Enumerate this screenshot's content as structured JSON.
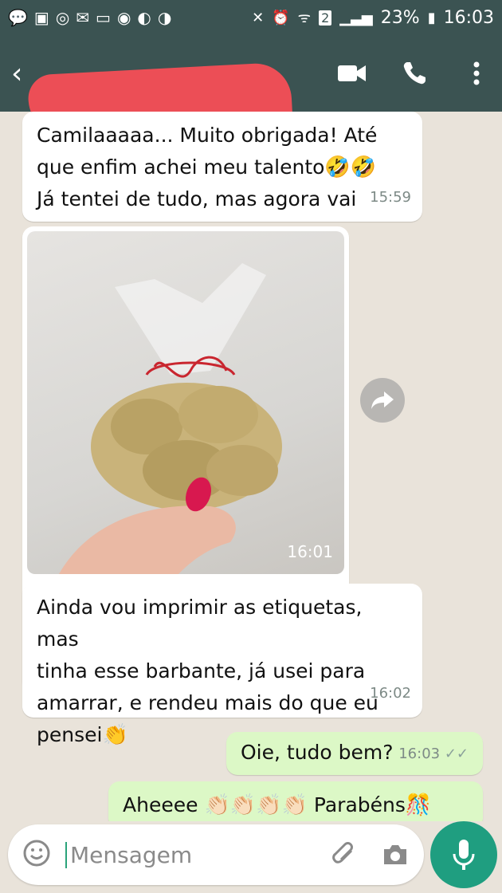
{
  "status_bar": {
    "battery": "23%",
    "time": "16:03",
    "sim": "2"
  },
  "header": {
    "contact_name": ""
  },
  "messages": [
    {
      "line1": "Camilaaaaa... Muito obrigada! Até",
      "line2": "que enfim achei meu talento",
      "line2_emoji": "🤣🤣",
      "line3": "Já tentei de tudo, mas agora vai",
      "time": "15:59"
    },
    {
      "type": "photo",
      "time": "16:01"
    },
    {
      "line1": "Ainda vou imprimir as etiquetas, mas",
      "line2": "tinha esse barbante, já usei para",
      "line3": "amarrar, e rendeu mais do que eu",
      "line4": "pensei",
      "line4_emoji": "👏",
      "time": "16:02"
    },
    {
      "text": "Oie, tudo bem?",
      "time": "16:03",
      "status": "read"
    },
    {
      "text_before": "Aheeee",
      "emojis": "👏🏻👏🏻👏🏻👏🏻",
      "text_after": "Parabéns",
      "emoji_end": "🎊"
    }
  ],
  "composer": {
    "placeholder": "Mensagem"
  },
  "colors": {
    "header": "#3b5352",
    "chat_bg": "#e9e3da",
    "outgoing": "#dcf8c6",
    "mic": "#1f9e80",
    "redaction": "#ec4e56"
  }
}
